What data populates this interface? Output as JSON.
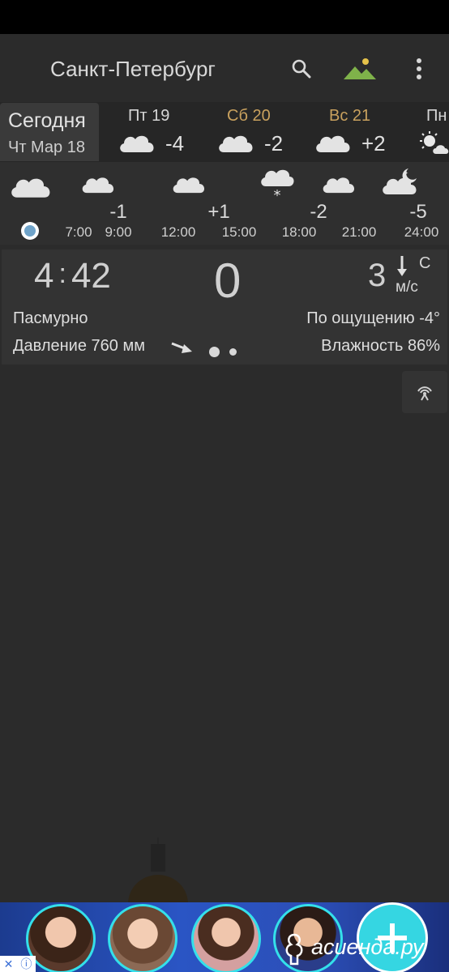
{
  "app": {
    "city": "Санкт-Петербург",
    "icons": [
      "search-icon",
      "landscape-icon",
      "more-vert-icon"
    ],
    "accent": "#c9a15e"
  },
  "days": {
    "today": {
      "label": "Сегодня",
      "date": "Чт Мар 18"
    },
    "list": [
      {
        "name": "Пт 19",
        "temp": "-4",
        "icon": "cloud-icon",
        "weekend": false
      },
      {
        "name": "Сб 20",
        "temp": "-2",
        "icon": "cloud-icon",
        "weekend": true
      },
      {
        "name": "Вс 21",
        "temp": "+2",
        "icon": "cloud-icon",
        "weekend": true
      },
      {
        "name": "Пн",
        "temp": "",
        "icon": "sun-cloud-icon",
        "weekend": false
      }
    ]
  },
  "hourly": {
    "temps": [
      "-1",
      "+1",
      "-2",
      "-5"
    ],
    "times": [
      "7:00",
      "9:00",
      "12:00",
      "15:00",
      "18:00",
      "21:00",
      "24:00"
    ],
    "icons": [
      "cloud-icon",
      "cloud-icon",
      "cloud-icon",
      "snow-cloud-icon",
      "cloud-icon",
      "night-cloud-icon"
    ]
  },
  "current": {
    "time_h": "4",
    "time_m": "42",
    "temp": "0",
    "wind_speed": "3",
    "wind_dir": "С",
    "wind_unit": "м/с",
    "condition": "Пасмурно",
    "feels_like": "По ощущению -4°",
    "pressure": "Давление 760 мм",
    "humidity": "Влажность 86%"
  },
  "ad": {
    "text": "асиенда.ру",
    "close": "✕",
    "info": "ⓘ"
  }
}
